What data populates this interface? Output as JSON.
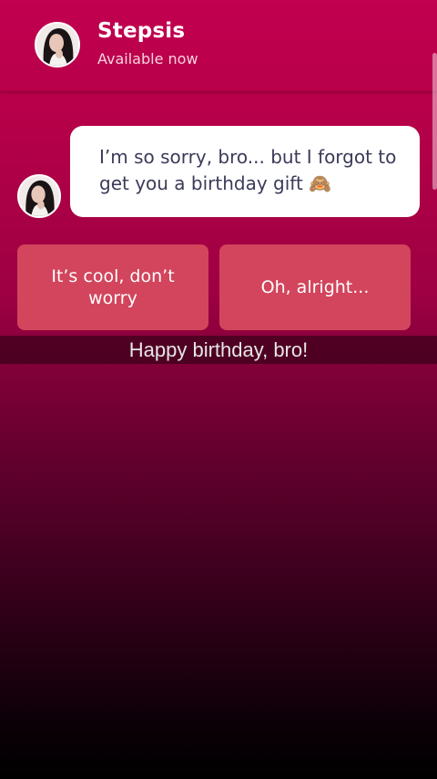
{
  "header": {
    "name": "Stepsis",
    "status": "Available now"
  },
  "message": {
    "text": "I’m so sorry, bro... but I forgot to get you a birthday gift",
    "emoji": "🙈"
  },
  "choices": [
    {
      "label": "It’s cool, don’t worry"
    },
    {
      "label": "Oh, alright..."
    }
  ],
  "subtitle": "Happy birthday, bro!",
  "icons": {
    "avatar": "profile-photo"
  }
}
